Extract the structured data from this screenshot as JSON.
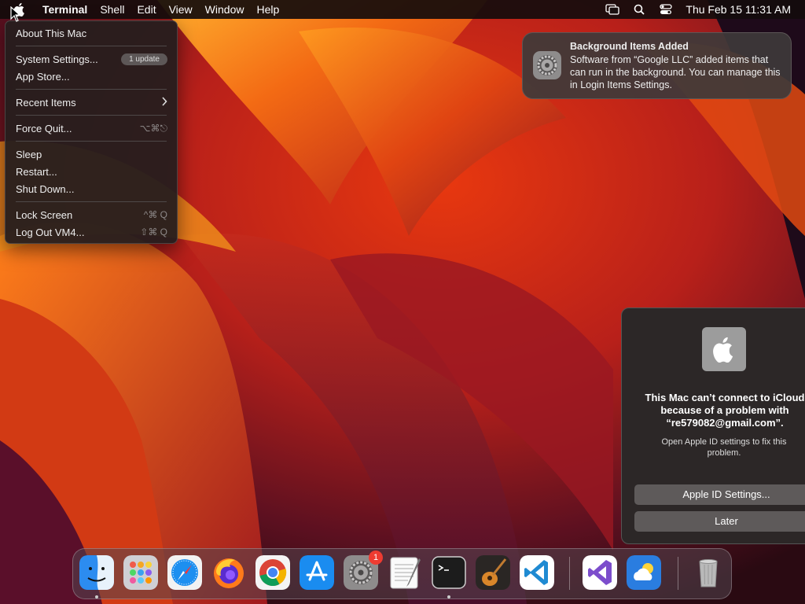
{
  "menubar": {
    "app_name": "Terminal",
    "menus": [
      "Shell",
      "Edit",
      "View",
      "Window",
      "Help"
    ],
    "status_icons": [
      "screen-mirroring-icon",
      "spotlight-search-icon",
      "control-center-icon"
    ],
    "clock": "Thu Feb 15  11:31 AM"
  },
  "apple_menu": {
    "about": "About This Mac",
    "system_settings": "System Settings...",
    "update_badge": "1 update",
    "app_store": "App Store...",
    "recent_items": "Recent Items",
    "force_quit": "Force Quit...",
    "force_quit_shortcut": "⌥⌘⎋",
    "sleep": "Sleep",
    "restart": "Restart...",
    "shut_down": "Shut Down...",
    "lock_screen": "Lock Screen",
    "lock_screen_shortcut": "^⌘ Q",
    "log_out": "Log Out VM4...",
    "log_out_shortcut": "⇧⌘ Q"
  },
  "notification": {
    "title": "Background Items Added",
    "body": "Software from “Google LLC” added items that can run in the background. You can manage this in Login Items Settings.",
    "icon": "system-settings-gear-icon"
  },
  "icloud_alert": {
    "message": "This Mac can’t connect to iCloud because of a problem with “re579082@gmail.com”.",
    "info": "Open Apple ID settings to fix this problem.",
    "primary_button": "Apple ID Settings...",
    "secondary_button": "Later"
  },
  "dock": {
    "apps": [
      "Finder",
      "Launchpad",
      "Safari",
      "Firefox",
      "Google Chrome",
      "App Store",
      "System Settings",
      "TextEdit",
      "Terminal",
      "GarageBand",
      "Visual Studio Code",
      "Visual Studio",
      "Weather",
      "Trash"
    ],
    "system_settings_badge": "1",
    "running": [
      "Finder",
      "Terminal"
    ]
  },
  "colors": {
    "menubar_bg": "#140c0c",
    "menu_bg": "#261e1e",
    "badge_red": "#ee3b31",
    "alert_button": "#5e5a5a"
  }
}
